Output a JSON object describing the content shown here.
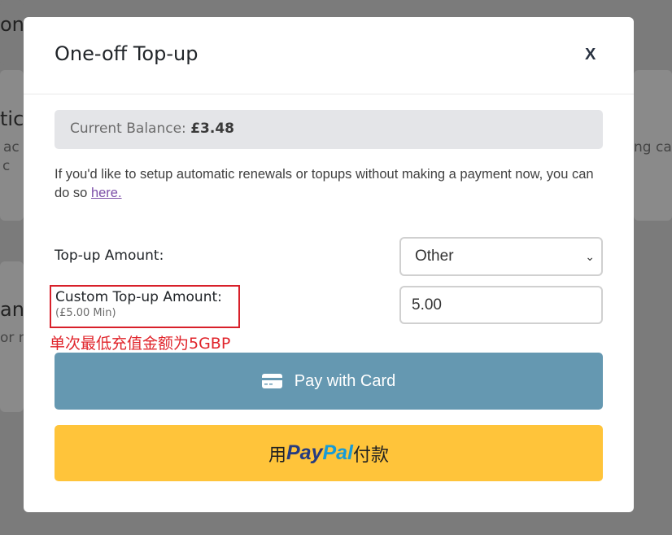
{
  "background": {
    "fragments": [
      "on",
      "tic",
      "ac",
      "c",
      "ng ca",
      "ans",
      "or n"
    ]
  },
  "modal": {
    "title": "One-off Top-up",
    "close_label": "X",
    "balance_label": "Current Balance:",
    "balance_value": "£3.48",
    "info_text": "If you'd like to setup automatic renewals or topups without making a payment now, you can do so ",
    "info_link": "here."
  },
  "form": {
    "topup_label": "Top-up Amount:",
    "topup_selected": "Other",
    "custom_label": "Custom Top-up Amount:",
    "custom_min": "(£5.00 Min)",
    "custom_value": "5.00",
    "annotation": "单次最低充值金额为5GBP"
  },
  "buttons": {
    "card_label": "Pay with Card",
    "paypal_prefix": "用",
    "paypal_pay": "Pay",
    "paypal_pal": "Pal",
    "paypal_suffix": "付款"
  },
  "colors": {
    "card_button": "#6598b1",
    "paypal_button": "#ffc43a",
    "annotation": "#e0242b"
  }
}
